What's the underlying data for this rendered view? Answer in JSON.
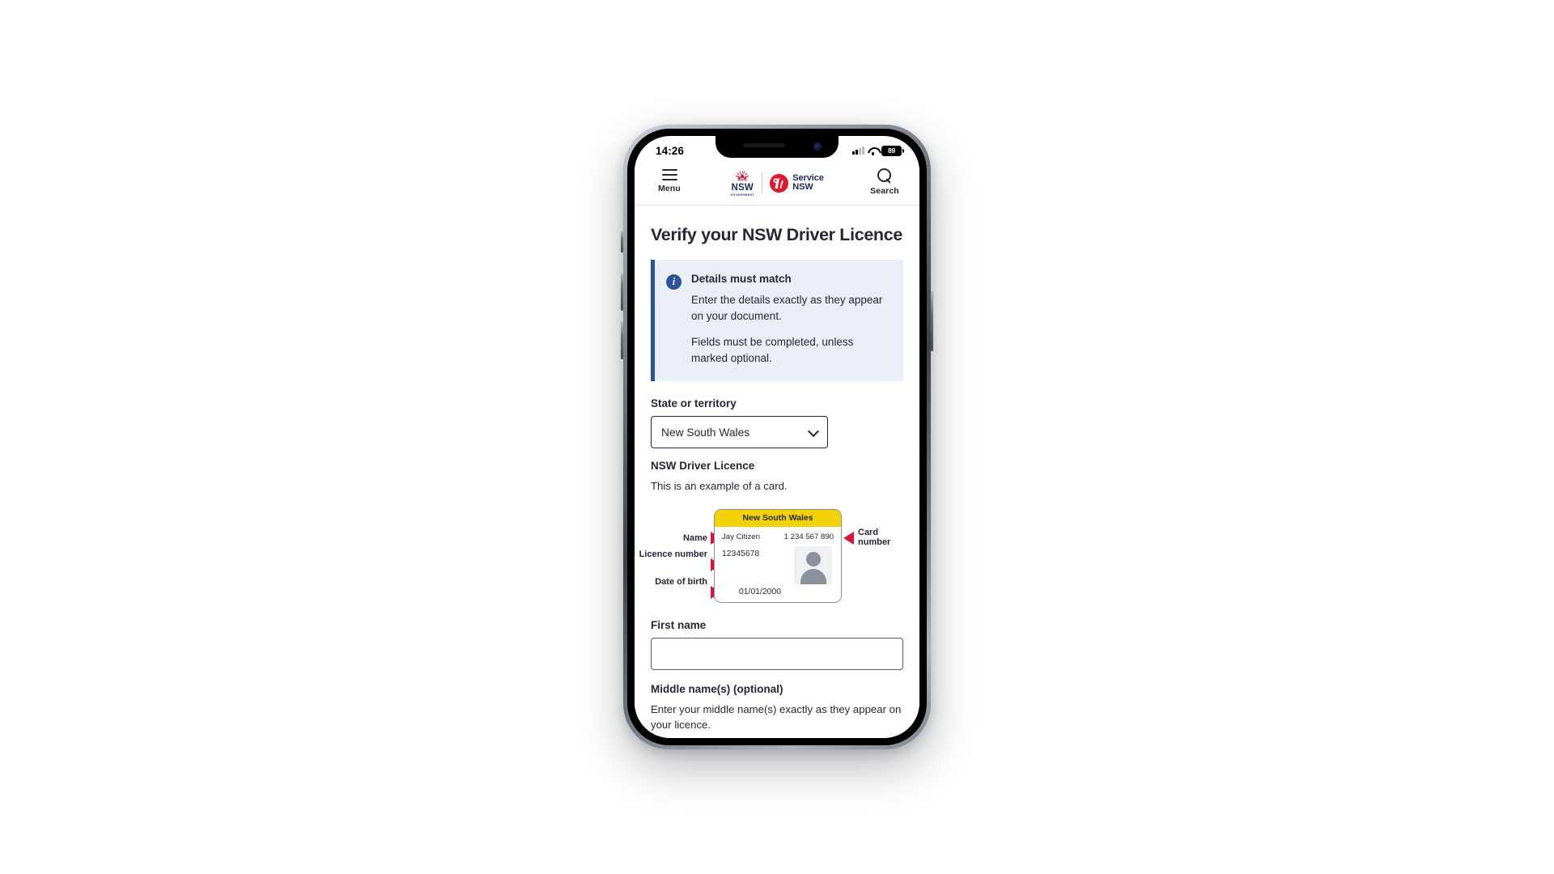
{
  "status_bar": {
    "time": "14:26",
    "battery_percent": "89",
    "signal_icon": "cellular-signal-icon",
    "wifi_icon": "wifi-icon",
    "battery_icon": "battery-icon"
  },
  "site_header": {
    "menu_label": "Menu",
    "menu_icon": "hamburger-menu-icon",
    "search_label": "Search",
    "search_icon": "search-icon",
    "nsw_gov_logo": {
      "wordmark": "NSW",
      "subword": "GOVERNMENT",
      "icon": "nsw-waratah-icon",
      "color": "#d7153a"
    },
    "service_nsw_logo": {
      "line1": "Service",
      "line2": "NSW",
      "icon": "service-nsw-roundel-icon",
      "color": "#e0182d"
    }
  },
  "page": {
    "title": "Verify your NSW Driver Licence"
  },
  "callout": {
    "icon": "info-icon",
    "accent_color": "#2e5299",
    "background_color": "#eaeef7",
    "title": "Details must match",
    "paragraphs": [
      "Enter the details exactly as they appear on your document.",
      "Fields must be completed, unless marked optional."
    ]
  },
  "form": {
    "state": {
      "label": "State or territory",
      "selected_value": "New South Wales",
      "chevron_icon": "chevron-down-icon"
    },
    "card_example": {
      "heading": "NSW Driver Licence",
      "subtext": "This is an example of a card.",
      "band_text": "New South Wales",
      "band_color": "#f2d202",
      "pointer_color": "#d7153a",
      "callouts": [
        {
          "label": "Name",
          "value": "Jay Citizen",
          "side": "left"
        },
        {
          "label": "Card number",
          "value": "1 234 567 890",
          "side": "right"
        },
        {
          "label": "Licence number",
          "value": "12345678",
          "side": "left"
        },
        {
          "label": "Date of birth",
          "value": "01/01/2000",
          "side": "left"
        }
      ],
      "photo_icon": "person-placeholder-icon"
    },
    "first_name": {
      "label": "First name",
      "value": "",
      "placeholder": ""
    },
    "middle_names": {
      "label": "Middle name(s) (optional)",
      "hint": "Enter your middle name(s) exactly as they appear on your licence.",
      "value": "",
      "placeholder": ""
    }
  }
}
